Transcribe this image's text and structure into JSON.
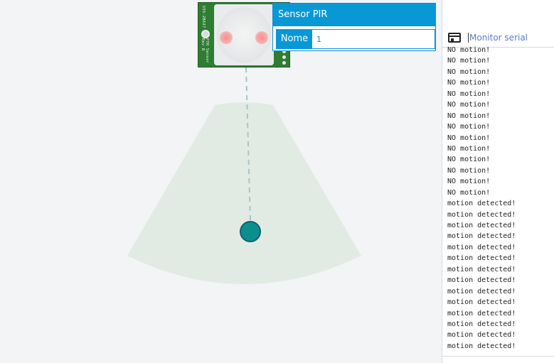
{
  "sensor": {
    "board_label_1": "SS5-2BA27",
    "board_label_2": "PIR Sensor Rev B"
  },
  "properties": {
    "title": "Sensor PIR",
    "field_label": "Nome",
    "field_value": "1"
  },
  "serial_monitor": {
    "title": "Monitor serial",
    "lines": [
      "NO motion!",
      "NO motion!",
      "NO motion!",
      "NO motion!",
      "NO motion!",
      "NO motion!",
      "NO motion!",
      "NO motion!",
      "NO motion!",
      "NO motion!",
      "NO motion!",
      "NO motion!",
      "NO motion!",
      "NO motion!",
      "motion detected!",
      "motion detected!",
      "motion detected!",
      "motion detected!",
      "motion detected!",
      "motion detected!",
      "motion detected!",
      "motion detected!",
      "motion detected!",
      "motion detected!",
      "motion detected!",
      "motion detected!",
      "motion detected!",
      "motion detected!"
    ]
  },
  "colors": {
    "accent": "#0898d6",
    "detection_zone": "#e2ebe3",
    "target": "#0b8f8c"
  }
}
